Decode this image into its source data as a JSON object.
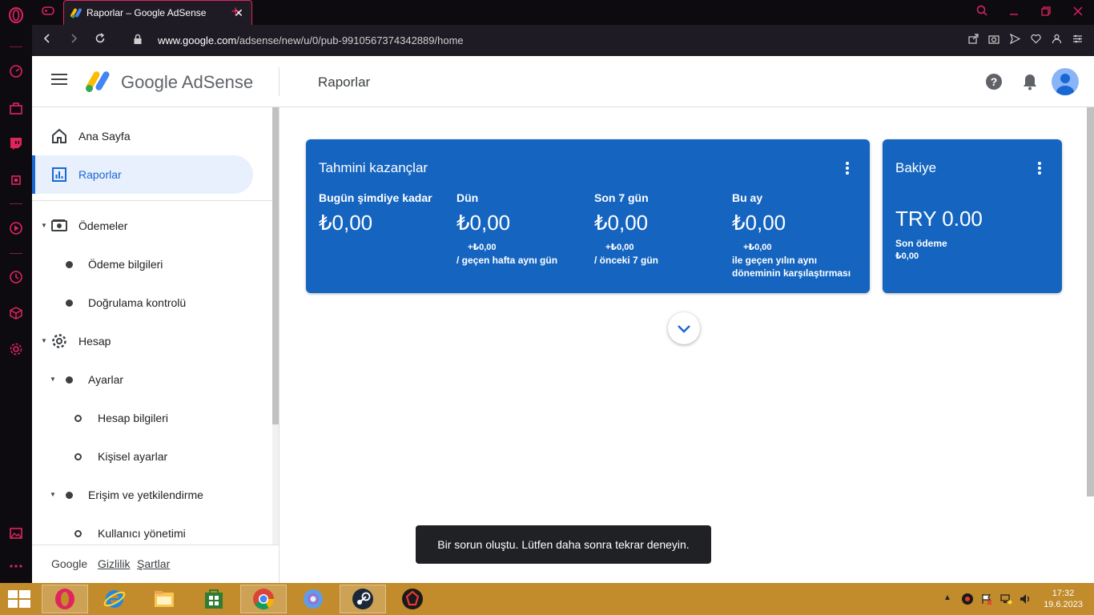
{
  "browser": {
    "tab_title": "Raporlar – Google AdSense",
    "tab_close": "✕",
    "new_tab": "+",
    "url_host": "www.google.com",
    "url_path": "/adsense/new/u/0/pub-9910567374342889/home",
    "accent_color": "#e0245e"
  },
  "header": {
    "brand": "Google AdSense",
    "page_title": "Raporlar",
    "help_label": "?"
  },
  "nav": {
    "items": [
      {
        "label": "Ana Sayfa",
        "icon": "home-icon"
      },
      {
        "label": "Raporlar",
        "icon": "bar-chart-icon",
        "active": true
      },
      {
        "label": "Ödemeler",
        "icon": "payments-icon"
      },
      {
        "label": "Ödeme bilgileri"
      },
      {
        "label": "Doğrulama kontrolü"
      },
      {
        "label": "Hesap",
        "icon": "gear-icon"
      },
      {
        "label": "Ayarlar"
      },
      {
        "label": "Hesap bilgileri"
      },
      {
        "label": "Kişisel ayarlar"
      },
      {
        "label": "Erişim ve yetkilendirme"
      },
      {
        "label": "Kullanıcı yönetimi"
      }
    ]
  },
  "footer": {
    "google": "Google",
    "privacy": "Gizlilik",
    "terms": "Şartlar"
  },
  "earnings_card": {
    "title": "Tahmini kazançlar",
    "metrics": [
      {
        "label": "Bugün şimdiye kadar",
        "value": "₺0,00",
        "delta": "",
        "note": ""
      },
      {
        "label": "Dün",
        "value": "₺0,00",
        "delta": "+₺0,00",
        "note": "/ geçen hafta aynı gün"
      },
      {
        "label": "Son 7 gün",
        "value": "₺0,00",
        "delta": "+₺0,00",
        "note": "/ önceki 7 gün"
      },
      {
        "label": "Bu ay",
        "value": "₺0,00",
        "delta": "+₺0,00",
        "note": "ile geçen yılın aynı döneminin karşılaştırması"
      }
    ]
  },
  "balance_card": {
    "title": "Bakiye",
    "value": "TRY 0.00",
    "last_payment_label": "Son ödeme",
    "last_payment_value": "₺0,00"
  },
  "snackbar": {
    "message": "Bir sorun oluştu. Lütfen daha sonra tekrar deneyin."
  },
  "taskbar": {
    "time": "17:32",
    "date": "19.6.2023",
    "color": "#c28b2b"
  }
}
